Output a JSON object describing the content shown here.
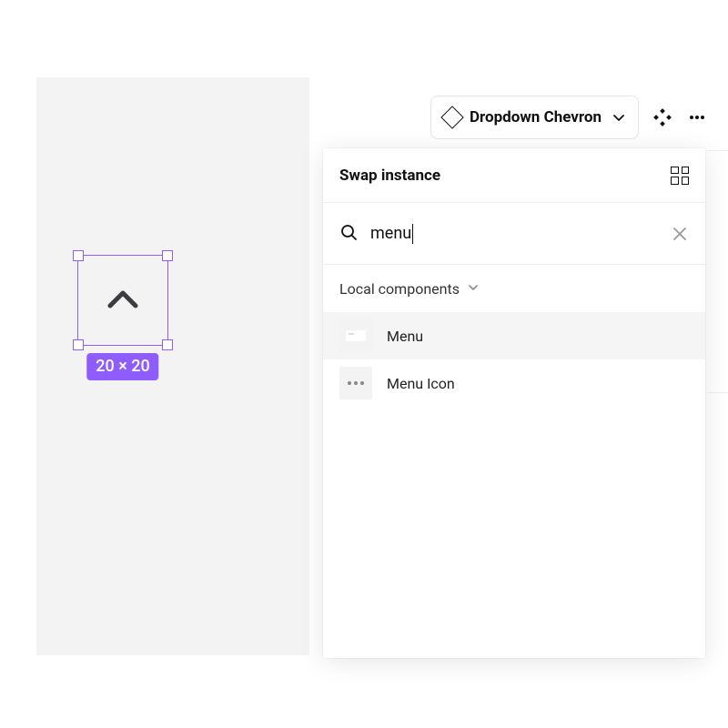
{
  "canvas": {
    "selected_component": {
      "icon": "chevron-up",
      "dimensions_label": "20 × 20"
    }
  },
  "toolbar": {
    "instance_name": "Dropdown Chevron"
  },
  "panel": {
    "title": "Swap instance",
    "search_value": "menu",
    "section_label": "Local components",
    "results": [
      {
        "name": "Menu",
        "thumb": "menu",
        "selected": true
      },
      {
        "name": "Menu Icon",
        "thumb": "dots",
        "selected": false
      }
    ]
  },
  "colors": {
    "selection": "#8f5cff"
  }
}
